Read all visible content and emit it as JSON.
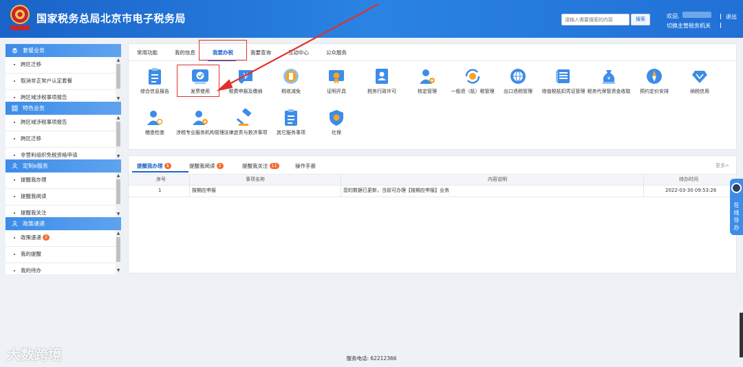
{
  "header": {
    "title": "国家税务总局北京市电子税务局",
    "search_placeholder": "请输入需要搜索的内容",
    "search_button": "搜索",
    "welcome": "欢迎,",
    "switch_org": "切换主管税务机关",
    "logout": "退出"
  },
  "sidebar": {
    "sections": [
      {
        "title": "套餐业务",
        "icon": "stack-icon",
        "items": [
          {
            "label": "跨区迁移"
          },
          {
            "label": "取消非正常户认定套餐"
          },
          {
            "label": "跨区域涉税事项报告"
          }
        ]
      },
      {
        "title": "特色业务",
        "icon": "grid-icon",
        "items": [
          {
            "label": "跨区域涉税事项报告"
          },
          {
            "label": "跨区迁移"
          },
          {
            "label": "非营利组织免税资格申请"
          }
        ]
      },
      {
        "title": "定制e服务",
        "icon": "person-icon",
        "items": [
          {
            "label": "提醒我办理"
          },
          {
            "label": "提醒我阅读"
          },
          {
            "label": "提醒我关注"
          }
        ]
      },
      {
        "title": "政策速递",
        "icon": "person-icon",
        "items": [
          {
            "label": "政策速递",
            "badge": "2"
          },
          {
            "label": "我的提醒"
          },
          {
            "label": "我的待办"
          }
        ]
      }
    ]
  },
  "main": {
    "tabs": [
      {
        "label": "常用功能"
      },
      {
        "label": "我的信息"
      },
      {
        "label": "我要办税"
      },
      {
        "label": "我要查询"
      },
      {
        "label": "互动中心"
      },
      {
        "label": "公众服务"
      }
    ],
    "active_tab": "我要办税",
    "functions": [
      {
        "label": "综合信息报告",
        "icon": "clipboard-icon"
      },
      {
        "label": "发票使用",
        "icon": "invoice-check-icon"
      },
      {
        "label": "税费申报及缴纳",
        "icon": "yuan-tag-icon"
      },
      {
        "label": "税收减免",
        "icon": "coin-icon"
      },
      {
        "label": "证明开具",
        "icon": "certificate-icon"
      },
      {
        "label": "税务行政许可",
        "icon": "id-card-icon"
      },
      {
        "label": "核定管理",
        "icon": "user-gear-icon"
      },
      {
        "label": "一般退（抵）税管理",
        "icon": "refund-icon"
      },
      {
        "label": "出口退税管理",
        "icon": "globe-icon"
      },
      {
        "label": "增值税抵扣凭证管理",
        "icon": "ledger-icon"
      },
      {
        "label": "税务代保管资金收取",
        "icon": "money-bag-icon"
      },
      {
        "label": "预约定价安排",
        "icon": "compass-icon"
      },
      {
        "label": "纳税信用",
        "icon": "diamond-icon"
      },
      {
        "label": "稽查检查",
        "icon": "user-search-icon"
      },
      {
        "label": "涉税专业服务机构管理",
        "icon": "user-gear-icon"
      },
      {
        "label": "法律追责与救济事项",
        "icon": "gavel-icon"
      },
      {
        "label": "其它服务事项",
        "icon": "clipboard-icon"
      },
      {
        "label": "社保",
        "icon": "shield-icon"
      }
    ]
  },
  "reminders": {
    "tabs": [
      {
        "label": "提醒我办理",
        "badge": "1"
      },
      {
        "label": "提醒我阅读",
        "badge": "2"
      },
      {
        "label": "提醒我关注",
        "badge": "11"
      },
      {
        "label": "操作手册"
      }
    ],
    "more": "更多>",
    "columns": [
      "序号",
      "事项名称",
      "内容说明",
      "待办时间"
    ],
    "rows": [
      {
        "index": "1",
        "name": "按期应申报",
        "desc": "您的数据已更新，当前可办理【按期应申报】业务",
        "time": "2022-03-30 09:53:26"
      }
    ]
  },
  "float_helper": "在线导办",
  "footer": "服务电话: 62212366",
  "watermark": "大数跨境",
  "colors": {
    "brand": "#1a63c8",
    "highlight": "#e0312c",
    "badge": "#f56c2d"
  }
}
